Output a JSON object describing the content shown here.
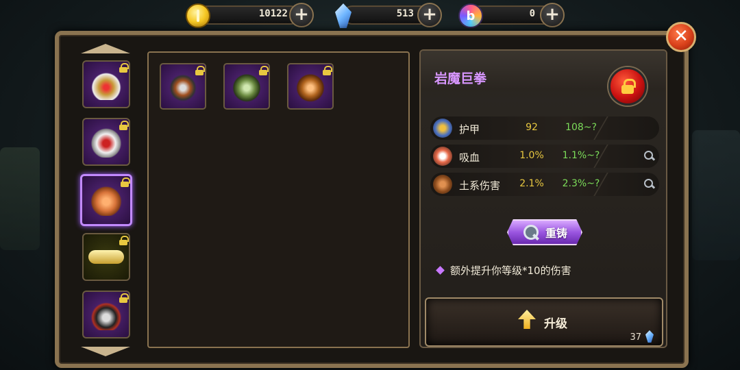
{
  "currencies": {
    "gold": {
      "value": "10122",
      "icon": "gold-coin-icon"
    },
    "crystal": {
      "value": "513",
      "icon": "blue-crystal-icon"
    },
    "gem": {
      "value": "0",
      "icon": "rainbow-gem-icon",
      "glyph": "b"
    }
  },
  "close_glyph": "✕",
  "plus_glyph": "+",
  "categories": [
    {
      "name": "helmet",
      "locked": true,
      "selected": false
    },
    {
      "name": "armor",
      "locked": true,
      "selected": false
    },
    {
      "name": "gauntlet",
      "locked": true,
      "selected": true
    },
    {
      "name": "belt",
      "locked": true,
      "selected": false
    },
    {
      "name": "boots",
      "locked": true,
      "selected": false
    }
  ],
  "inventory": [
    {
      "name": "gauntlet-1",
      "locked": true
    },
    {
      "name": "gauntlet-2",
      "locked": true
    },
    {
      "name": "gauntlet-3",
      "locked": true
    }
  ],
  "detail": {
    "item_name": "岩魔巨拳",
    "stats": [
      {
        "label": "护甲",
        "current": "92",
        "next": "108~?",
        "icon": "shield-icon"
      },
      {
        "label": "吸血",
        "current": "1.0%",
        "next": "1.1%~?",
        "icon": "fang-icon"
      },
      {
        "label": "土系伤害",
        "current": "2.1%",
        "next": "2.3%~?",
        "icon": "earth-icon"
      }
    ],
    "reforge_label": "重铸",
    "bonus_text": "额外提升你等级*10的伤害",
    "upgrade_label": "升级",
    "upgrade_cost": "37"
  },
  "colors": {
    "frame": "#8a7350",
    "epic_purple": "#c28aff",
    "item_name": "#d896ff",
    "stat_current": "#e8c840",
    "stat_next": "#7cdc5a"
  }
}
